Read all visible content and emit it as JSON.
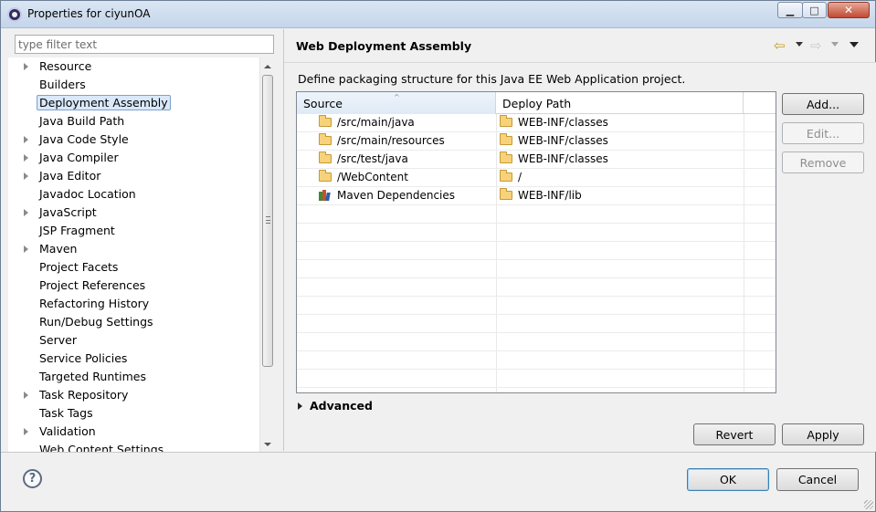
{
  "window": {
    "title": "Properties for ciyunOA",
    "minimize_glyph": "▁",
    "maximize_glyph": "□",
    "close_glyph": "✕"
  },
  "filter": {
    "placeholder": "type filter text"
  },
  "tree": {
    "items": [
      {
        "label": "Resource",
        "has_children": true,
        "selected": false
      },
      {
        "label": "Builders",
        "has_children": false,
        "selected": false
      },
      {
        "label": "Deployment Assembly",
        "has_children": false,
        "selected": true
      },
      {
        "label": "Java Build Path",
        "has_children": false,
        "selected": false
      },
      {
        "label": "Java Code Style",
        "has_children": true,
        "selected": false
      },
      {
        "label": "Java Compiler",
        "has_children": true,
        "selected": false
      },
      {
        "label": "Java Editor",
        "has_children": true,
        "selected": false
      },
      {
        "label": "Javadoc Location",
        "has_children": false,
        "selected": false
      },
      {
        "label": "JavaScript",
        "has_children": true,
        "selected": false
      },
      {
        "label": "JSP Fragment",
        "has_children": false,
        "selected": false
      },
      {
        "label": "Maven",
        "has_children": true,
        "selected": false
      },
      {
        "label": "Project Facets",
        "has_children": false,
        "selected": false
      },
      {
        "label": "Project References",
        "has_children": false,
        "selected": false
      },
      {
        "label": "Refactoring History",
        "has_children": false,
        "selected": false
      },
      {
        "label": "Run/Debug Settings",
        "has_children": false,
        "selected": false
      },
      {
        "label": "Server",
        "has_children": false,
        "selected": false
      },
      {
        "label": "Service Policies",
        "has_children": false,
        "selected": false
      },
      {
        "label": "Targeted Runtimes",
        "has_children": false,
        "selected": false
      },
      {
        "label": "Task Repository",
        "has_children": true,
        "selected": false
      },
      {
        "label": "Task Tags",
        "has_children": false,
        "selected": false
      },
      {
        "label": "Validation",
        "has_children": true,
        "selected": false
      },
      {
        "label": "Web Content Settings",
        "has_children": false,
        "selected": false
      }
    ]
  },
  "page": {
    "title": "Web Deployment Assembly",
    "description": "Define packaging structure for this Java EE Web Application project."
  },
  "nav": {
    "back_glyph": "⇦",
    "forward_glyph": "⇨"
  },
  "table": {
    "columns": {
      "source": "Source",
      "deploy_path": "Deploy Path"
    },
    "sort_glyph": "^",
    "rows": [
      {
        "source": "/src/main/java",
        "deploy_path": "WEB-INF/classes",
        "icon": "folder-icon"
      },
      {
        "source": "/src/main/resources",
        "deploy_path": "WEB-INF/classes",
        "icon": "folder-icon"
      },
      {
        "source": "/src/test/java",
        "deploy_path": "WEB-INF/classes",
        "icon": "folder-icon"
      },
      {
        "source": "/WebContent",
        "deploy_path": "/",
        "icon": "folder-icon"
      },
      {
        "source": "Maven Dependencies",
        "deploy_path": "WEB-INF/lib",
        "icon": "library-icon"
      }
    ]
  },
  "buttons": {
    "add": "Add...",
    "edit": "Edit...",
    "remove": "Remove",
    "revert": "Revert",
    "apply": "Apply",
    "ok": "OK",
    "cancel": "Cancel"
  },
  "advanced": {
    "label": "Advanced"
  },
  "help": {
    "glyph": "?"
  }
}
